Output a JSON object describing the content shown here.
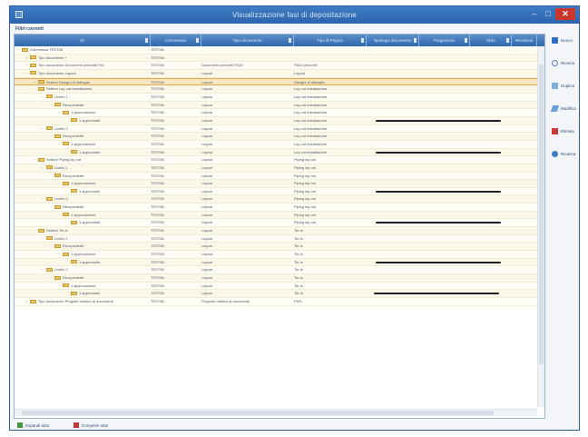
{
  "window": {
    "title": "Visualizzazione fasi di depositazione",
    "minimize_glyph": "–",
    "maximize_glyph": "□",
    "close_glyph": "✕"
  },
  "filter_label": "Filtri correnti",
  "columns": [
    "ID",
    "Commessa",
    "Tipo documento",
    "Tipo di Pagina",
    "Tipologia documento",
    "Progressivo",
    "Titolo",
    "Revisione"
  ],
  "rows": [
    {
      "level": 0,
      "toggle": "−",
      "label": "Commessa TEST56",
      "code": "TEST56",
      "type": "",
      "desc": "",
      "redacted": false,
      "selected": false
    },
    {
      "level": 1,
      "toggle": "+",
      "label": "Tipo documento *",
      "code": "TEST56",
      "type": "",
      "desc": "",
      "redacted": false,
      "selected": false
    },
    {
      "level": 1,
      "toggle": "+",
      "label": "Tipo documento Documenti prescritti P&I",
      "code": "TEST56",
      "type": "Documenti prescritti P&ID",
      "desc": "P&ID prescritti",
      "redacted": false,
      "selected": false
    },
    {
      "level": 1,
      "toggle": "−",
      "label": "Tipo documento Layout",
      "code": "TEST56",
      "type": "Layout",
      "desc": "Layout",
      "redacted": false,
      "selected": false
    },
    {
      "level": 2,
      "toggle": "+",
      "label": "Settore Disegni di dettaglio",
      "code": "TEST56",
      "type": "Layout",
      "desc": "Disegni di dettaglio",
      "redacted": false,
      "selected": true
    },
    {
      "level": 2,
      "toggle": "−",
      "label": "Settore Lay out installazione",
      "code": "TEST56",
      "type": "Layout",
      "desc": "Lay out installazione",
      "redacted": false,
      "selected": false
    },
    {
      "level": 3,
      "toggle": "−",
      "label": "Livello 1",
      "code": "TEST56",
      "type": "Layout",
      "desc": "Lay out installazione",
      "redacted": false,
      "selected": false
    },
    {
      "level": 4,
      "toggle": "−",
      "label": "Recuperabile",
      "code": "TEST56",
      "type": "Layout",
      "desc": "Lay out installazione",
      "redacted": false,
      "selected": false
    },
    {
      "level": 5,
      "toggle": "−",
      "label": "1 approvazione",
      "code": "TEST56",
      "type": "Layout",
      "desc": "Lay out installazione",
      "redacted": false,
      "selected": false
    },
    {
      "level": 6,
      "toggle": "",
      "label": "1 approvante",
      "code": "TEST56",
      "type": "Layout",
      "desc": "Lay out installazione",
      "redacted": true,
      "selected": false
    },
    {
      "level": 3,
      "toggle": "−",
      "label": "Livello 2",
      "code": "TEST56",
      "type": "Layout",
      "desc": "Lay out installazione",
      "redacted": false,
      "selected": false
    },
    {
      "level": 4,
      "toggle": "−",
      "label": "Recuperabile",
      "code": "TEST56",
      "type": "Layout",
      "desc": "Lay out installazione",
      "redacted": false,
      "selected": false
    },
    {
      "level": 5,
      "toggle": "−",
      "label": "1 approvazione",
      "code": "TEST56",
      "type": "Layout",
      "desc": "Lay out installazione",
      "redacted": false,
      "selected": false
    },
    {
      "level": 6,
      "toggle": "",
      "label": "1 approvante",
      "code": "TEST56",
      "type": "Layout",
      "desc": "Lay out installazione",
      "redacted": true,
      "selected": false
    },
    {
      "level": 2,
      "toggle": "−",
      "label": "Settore Piping lay out",
      "code": "TEST56",
      "type": "Layout",
      "desc": "Piping lay out",
      "redacted": false,
      "selected": false
    },
    {
      "level": 3,
      "toggle": "−",
      "label": "Livello 1",
      "code": "TEST56",
      "type": "Layout",
      "desc": "Piping lay out",
      "redacted": false,
      "selected": false
    },
    {
      "level": 4,
      "toggle": "−",
      "label": "Recuperabile",
      "code": "TEST56",
      "type": "Layout",
      "desc": "Piping lay out",
      "redacted": false,
      "selected": false
    },
    {
      "level": 5,
      "toggle": "−",
      "label": "1 approvazione",
      "code": "TEST56",
      "type": "Layout",
      "desc": "Piping lay out",
      "redacted": false,
      "selected": false
    },
    {
      "level": 6,
      "toggle": "",
      "label": "1 approvante",
      "code": "TEST56",
      "type": "Layout",
      "desc": "Piping lay out",
      "redacted": true,
      "selected": false
    },
    {
      "level": 3,
      "toggle": "−",
      "label": "Livello 2",
      "code": "TEST56",
      "type": "Layout",
      "desc": "Piping lay out",
      "redacted": false,
      "selected": false
    },
    {
      "level": 4,
      "toggle": "−",
      "label": "Recuperabile",
      "code": "TEST56",
      "type": "Layout",
      "desc": "Piping lay out",
      "redacted": false,
      "selected": false
    },
    {
      "level": 5,
      "toggle": "−",
      "label": "1 approvazione",
      "code": "TEST56",
      "type": "Layout",
      "desc": "Piping lay out",
      "redacted": false,
      "selected": false
    },
    {
      "level": 6,
      "toggle": "",
      "label": "1 approvante",
      "code": "TEST56",
      "type": "Layout",
      "desc": "Piping lay out",
      "redacted": true,
      "selected": false
    },
    {
      "level": 2,
      "toggle": "−",
      "label": "Settore Tie-in",
      "code": "TEST56",
      "type": "Layout",
      "desc": "Tie-in",
      "redacted": false,
      "selected": false
    },
    {
      "level": 3,
      "toggle": "−",
      "label": "Livello 1",
      "code": "TEST56",
      "type": "Layout",
      "desc": "Tie-in",
      "redacted": false,
      "selected": false
    },
    {
      "level": 4,
      "toggle": "−",
      "label": "Recuperabile",
      "code": "TEST56",
      "type": "Layout",
      "desc": "Tie-in",
      "redacted": false,
      "selected": false
    },
    {
      "level": 5,
      "toggle": "−",
      "label": "1 approvazione",
      "code": "TEST56",
      "type": "Layout",
      "desc": "Tie-in",
      "redacted": false,
      "selected": false
    },
    {
      "level": 6,
      "toggle": "",
      "label": "1 approvante",
      "code": "TEST56",
      "type": "Layout",
      "desc": "Tie-in",
      "redacted": true,
      "selected": false
    },
    {
      "level": 3,
      "toggle": "−",
      "label": "Livello 2",
      "code": "TEST56",
      "type": "Layout",
      "desc": "Tie-in",
      "redacted": false,
      "selected": false
    },
    {
      "level": 4,
      "toggle": "−",
      "label": "Recuperabile",
      "code": "TEST56",
      "type": "Layout",
      "desc": "Tie-in",
      "redacted": false,
      "selected": false
    },
    {
      "level": 5,
      "toggle": "−",
      "label": "1 approvazione",
      "code": "TEST56",
      "type": "Layout",
      "desc": "Tie-in",
      "redacted": false,
      "selected": false
    },
    {
      "level": 6,
      "toggle": "",
      "label": "1 approvante",
      "code": "TEST56",
      "type": "Layout",
      "desc": "Tie-in",
      "redacted": true,
      "selected": false
    },
    {
      "level": 1,
      "toggle": "+",
      "label": "Tipo documento Progetto relativo ai documenti",
      "code": "TEST56",
      "type": "Progetto relativo ai documenti",
      "desc": "PMS",
      "redacted": false,
      "selected": false
    }
  ],
  "side_buttons": [
    {
      "name": "new-button",
      "label": "Nuovo",
      "icon": "ic-new",
      "icon_name": "new-icon"
    },
    {
      "name": "search-button",
      "label": "Ricerca",
      "icon": "ic-find",
      "icon_name": "search-icon"
    },
    {
      "name": "duplicate-button",
      "label": "Duplica",
      "icon": "ic-dup",
      "icon_name": "duplicate-icon"
    },
    {
      "name": "edit-button",
      "label": "Modifica",
      "icon": "ic-edit",
      "icon_name": "edit-icon"
    },
    {
      "name": "delete-button",
      "label": "Elimina",
      "icon": "ic-del",
      "icon_name": "delete-icon"
    },
    {
      "name": "refresh-button",
      "label": "Ricarica",
      "icon": "ic-refresh",
      "icon_name": "refresh-icon"
    }
  ],
  "footer": {
    "expand_label": "Espandi tutto",
    "collapse_label": "Comprimi tutto"
  },
  "colors": {
    "titlebar": "#2b64ad",
    "header": "#3a72b8",
    "selected_row": "#fbe7c1",
    "folder": "#e9c567"
  }
}
